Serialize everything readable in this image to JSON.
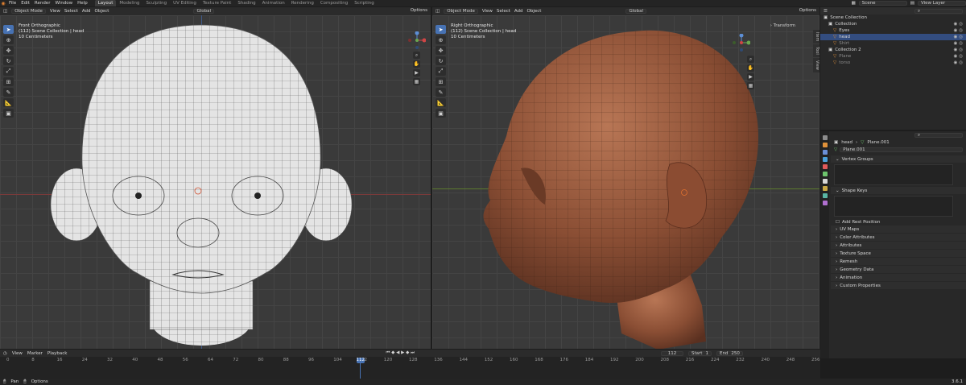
{
  "topbar": {
    "menu": [
      "File",
      "Edit",
      "Render",
      "Window",
      "Help"
    ],
    "workspaces": [
      "Layout",
      "Modeling",
      "Sculpting",
      "UV Editing",
      "Texture Paint",
      "Shading",
      "Animation",
      "Rendering",
      "Compositing",
      "Scripting"
    ],
    "active_workspace": "Layout",
    "scene": "Scene",
    "view_layer": "View Layer"
  },
  "left_viewport": {
    "mode": "Object Mode",
    "menu": [
      "View",
      "Select",
      "Add",
      "Object"
    ],
    "orientation": "Global",
    "options": "Options",
    "overlay_lines": [
      "Front Orthographic",
      "(112) Scene Collection | head",
      "10 Centimeters"
    ]
  },
  "right_viewport": {
    "mode": "Object Mode",
    "menu": [
      "View",
      "Select",
      "Add",
      "Object"
    ],
    "orientation": "Global",
    "options": "Options",
    "overlay_lines": [
      "Right Orthographic",
      "(112) Scene Collection | head",
      "10 Centimeters"
    ],
    "sidebar_panel": "Transform",
    "sidebar_tabs": [
      "Item",
      "Tool",
      "View"
    ]
  },
  "outliner": {
    "root": "Scene Collection",
    "rows": [
      {
        "label": "Collection",
        "depth": 1
      },
      {
        "label": "Eyes",
        "depth": 2
      },
      {
        "label": "head",
        "depth": 2
      },
      {
        "label": "Shirt",
        "depth": 2
      },
      {
        "label": "Collection 2",
        "depth": 1
      },
      {
        "label": "Plane",
        "depth": 2
      },
      {
        "label": "torso",
        "depth": 2
      }
    ]
  },
  "properties": {
    "breadcrumb_object": "head",
    "breadcrumb_mesh": "Plane.001",
    "mesh_name": "Plane.001",
    "sections": {
      "vertex_groups": "Vertex Groups",
      "shape_keys": "Shape Keys",
      "add_rest_position": "Add Rest Position",
      "collapsed": [
        "UV Maps",
        "Color Attributes",
        "Attributes",
        "Texture Space",
        "Remesh",
        "Geometry Data",
        "Animation",
        "Custom Properties"
      ]
    },
    "tab_colors": [
      "#8c8c8c",
      "#e0913a",
      "#6a8fd6",
      "#4aa0d8",
      "#e05a5a",
      "#6dc46d",
      "#d8d8d8",
      "#c9a845",
      "#59b5a3",
      "#b070d0"
    ]
  },
  "timeline": {
    "menu": [
      "View",
      "Marker",
      "Playback"
    ],
    "current_frame": "112",
    "start_label": "Start",
    "start": "1",
    "end_label": "End",
    "end": "250",
    "ruler": [
      "0",
      "8",
      "16",
      "24",
      "32",
      "40",
      "48",
      "56",
      "64",
      "72",
      "80",
      "88",
      "96",
      "104",
      "112",
      "120",
      "128",
      "136",
      "144",
      "152",
      "160",
      "168",
      "176",
      "184",
      "192",
      "200",
      "208",
      "216",
      "224",
      "232",
      "240",
      "248",
      "256"
    ]
  },
  "statusbar": {
    "left": "Pan",
    "middle": "Options",
    "version": "3.6.1"
  }
}
